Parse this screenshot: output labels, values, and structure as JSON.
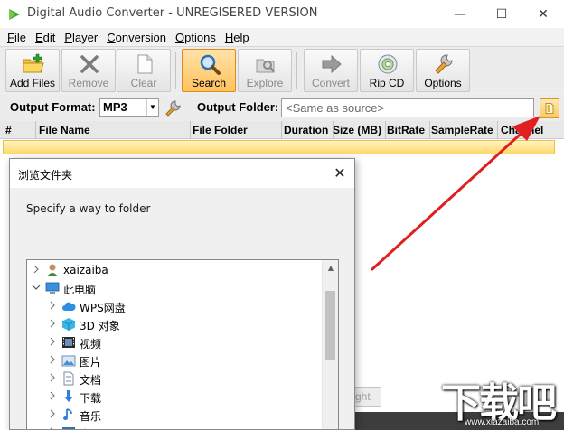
{
  "window": {
    "title": "Digital Audio Converter - UNREGISERED VERSION",
    "minimize_glyph": "—",
    "maximize_glyph": "☐",
    "close_glyph": "✕"
  },
  "menu": [
    {
      "u": "F",
      "rest": "ile"
    },
    {
      "u": "E",
      "rest": "dit"
    },
    {
      "u": "P",
      "rest": "layer"
    },
    {
      "u": "C",
      "rest": "onversion"
    },
    {
      "u": "O",
      "rest": "ptions"
    },
    {
      "u": "H",
      "rest": "elp"
    }
  ],
  "toolbar": {
    "add_files": "Add Files",
    "remove": "Remove",
    "clear": "Clear",
    "search": "Search",
    "explore": "Explore",
    "convert": "Convert",
    "rip_cd": "Rip CD",
    "options": "Options"
  },
  "output": {
    "format_label": "Output Format:",
    "format_value": "MP3",
    "folder_label": "Output Folder:",
    "folder_placeholder": "<Same as source>"
  },
  "table": {
    "columns": [
      "#",
      "File Name",
      "File Folder",
      "Duration",
      "Size (MB)",
      "BitRate",
      "SampleRate",
      "Channel"
    ]
  },
  "status_fragment": "ight",
  "dialog": {
    "title": "浏览文件夹",
    "description": "Specify a way to folder",
    "tree": [
      {
        "label": "xaizaiba",
        "icon": "user-icon",
        "expanded": false
      },
      {
        "label": "此电脑",
        "icon": "computer-icon",
        "expanded": true
      },
      {
        "label": "WPS网盘",
        "icon": "cloud-drive-icon",
        "expanded": false
      },
      {
        "label": "3D 对象",
        "icon": "3d-objects-icon",
        "expanded": false
      },
      {
        "label": "视频",
        "icon": "video-folder-icon",
        "expanded": false
      },
      {
        "label": "图片",
        "icon": "pictures-folder-icon",
        "expanded": false
      },
      {
        "label": "文档",
        "icon": "documents-folder-icon",
        "expanded": false
      },
      {
        "label": "下载",
        "icon": "download-folder-icon",
        "expanded": false
      },
      {
        "label": "音乐",
        "icon": "music-folder-icon",
        "expanded": false
      },
      {
        "label": "桌面",
        "icon": "desktop-folder-icon",
        "expanded": false
      }
    ]
  },
  "watermark": {
    "big": "下载吧",
    "small": "www.xiazaiba.com"
  },
  "colors": {
    "accent": "#ffc35e",
    "annotation": "#e02020"
  }
}
